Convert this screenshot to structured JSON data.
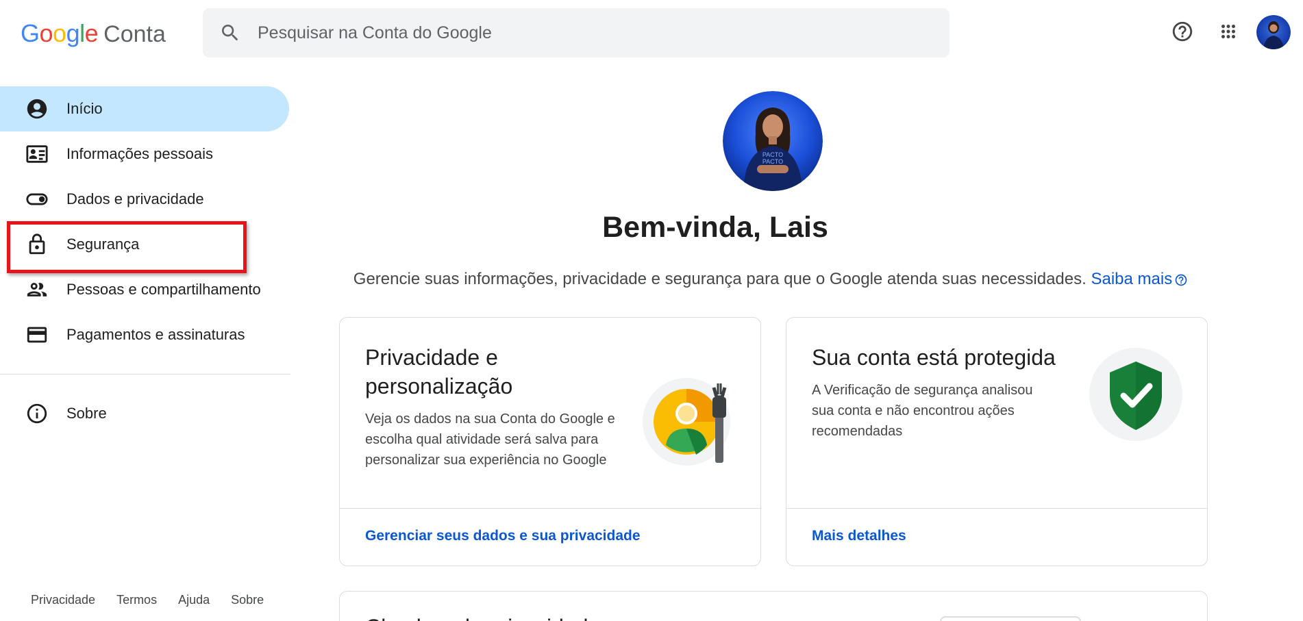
{
  "header": {
    "logo_google": "Google",
    "logo_product": "Conta",
    "search_placeholder": "Pesquisar na Conta do Google",
    "help_icon": "help-circle-icon",
    "apps_icon": "apps-grid-icon"
  },
  "sidebar": {
    "items": [
      {
        "label": "Início",
        "icon": "account-circle-icon"
      },
      {
        "label": "Informações pessoais",
        "icon": "id-card-icon"
      },
      {
        "label": "Dados e privacidade",
        "icon": "toggle-icon"
      },
      {
        "label": "Segurança",
        "icon": "lock-icon"
      },
      {
        "label": "Pessoas e compartilhamento",
        "icon": "people-icon"
      },
      {
        "label": "Pagamentos e assinaturas",
        "icon": "credit-card-icon"
      }
    ],
    "about": {
      "label": "Sobre",
      "icon": "info-icon"
    },
    "active_index": 0,
    "highlighted_index": 3,
    "highlight_color": "#e8141b"
  },
  "footer": {
    "links": [
      "Privacidade",
      "Termos",
      "Ajuda",
      "Sobre"
    ]
  },
  "main": {
    "welcome": "Bem-vinda, Lais",
    "intro_text": "Gerencie suas informações, privacidade e segurança para que o Google atenda suas necessidades.",
    "intro_link": "Saiba mais",
    "cards": [
      {
        "title": "Privacidade e personalização",
        "description": "Veja os dados na sua Conta do Google e escolha qual atividade será salva para personalizar sua experiência no Google",
        "link": "Gerenciar seus dados e sua privacidade"
      },
      {
        "title": "Sua conta está protegida",
        "description": "A Verificação de segurança analisou sua conta e não encontrou ações recomendadas",
        "link": "Mais detalhes"
      }
    ],
    "partial_card_title": "Checkup de privacidade"
  },
  "colors": {
    "accent_blue": "#0b57d0",
    "active_nav": "#c2e7ff",
    "shield_green": "#188038"
  }
}
